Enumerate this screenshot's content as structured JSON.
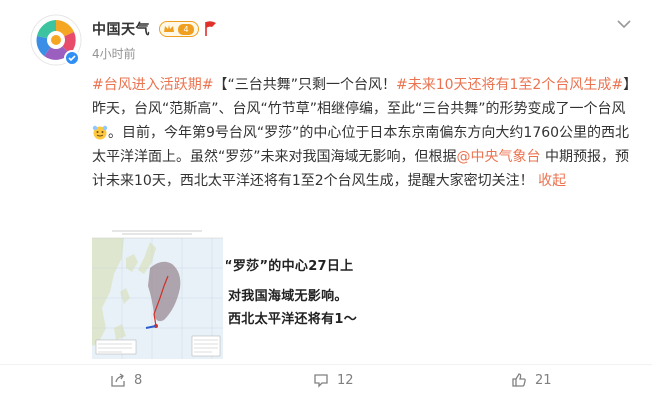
{
  "author": {
    "name": "中国天气",
    "level": "4"
  },
  "timestamp": "4小时前",
  "post": {
    "hashtag1": "#台风进入活跃期#",
    "text1": "【“三台共舞”只剩一个台风！",
    "hashtag2": "#未来10天还将有1至2个台风生成#",
    "text2": "】昨天，台风“范斯高”、台风“竹节草”相继停编，至此“三台共舞”的形势变成了一个台风",
    "text3": "。目前，今年第9号台风“罗莎”的中心位于日本东京南偏东方向大约1760公里的西北太平洋洋面上。虽然“罗莎”未来对我国海域无影响，但根据",
    "mention": "@中央气象台",
    "text4": " 中期预报，预计未来10天，西北太平洋还将有1至2个台风生成，提醒大家密切关注！ ",
    "collapse": "收起"
  },
  "image2_lines": [
    "“罗莎”的中心27日上",
    "对我国海域无影响。",
    "西北太平洋还将有1～"
  ],
  "actions": {
    "repost": "8",
    "comment": "12",
    "like": "21"
  },
  "colors": {
    "link": "#eb7350",
    "verified": "#2f8ff5",
    "muted": "#808080"
  }
}
